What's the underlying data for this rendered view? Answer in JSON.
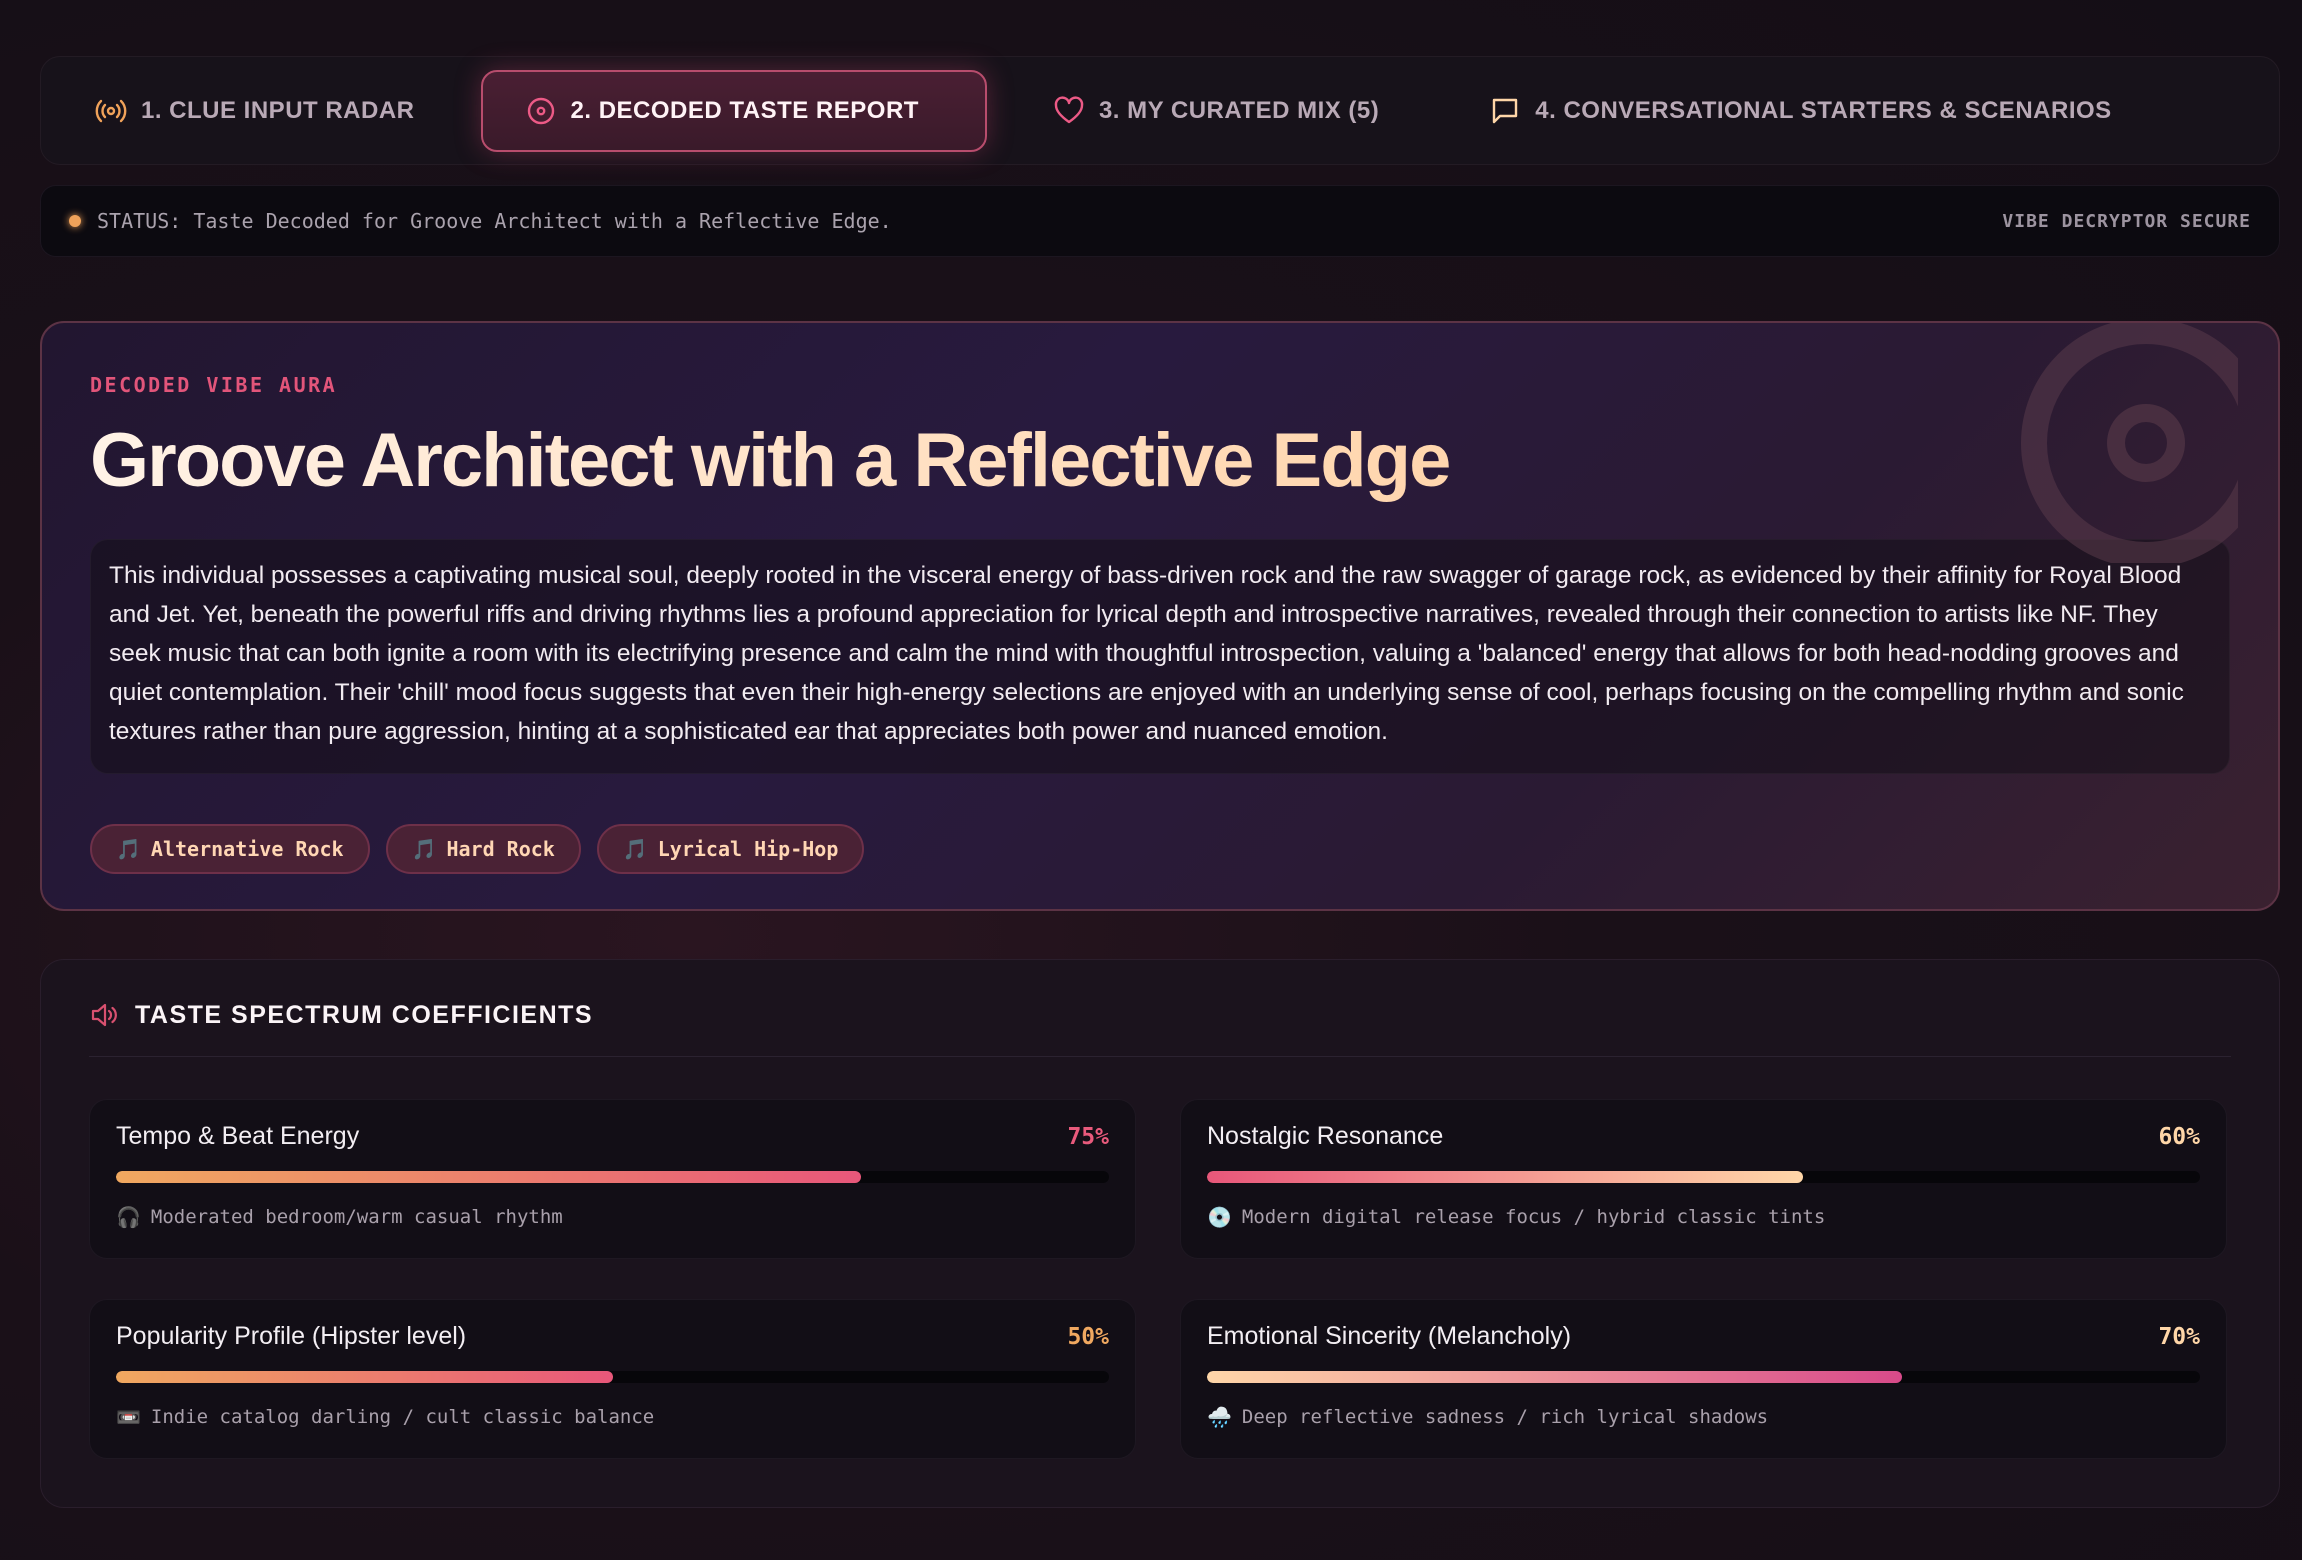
{
  "tabs": [
    {
      "label": "1. CLUE INPUT RADAR",
      "icon": "radio-broadcast-icon"
    },
    {
      "label": "2. DECODED TASTE REPORT",
      "icon": "disc-icon",
      "active": true
    },
    {
      "label": "3. MY CURATED MIX (5)",
      "icon": "heart-icon"
    },
    {
      "label": "4. CONVERSATIONAL STARTERS & SCENARIOS",
      "icon": "chat-bubble-icon"
    }
  ],
  "status": {
    "text": "STATUS: Taste Decoded for Groove Architect with a Reflective Edge.",
    "right": "VIBE DECRYPTOR SECURE"
  },
  "hero": {
    "eyebrow": "DECODED VIBE AURA",
    "title": "Groove Architect with a Reflective Edge",
    "description": "This individual possesses a captivating musical soul, deeply rooted in the visceral energy of bass-driven rock and the raw swagger of garage rock, as evidenced by their affinity for Royal Blood and Jet. Yet, beneath the powerful riffs and driving rhythms lies a profound appreciation for lyrical depth and introspective narratives, revealed through their connection to artists like NF. They seek music that can both ignite a room with its electrifying presence and calm the mind with thoughtful introspection, valuing a 'balanced' energy that allows for both head-nodding grooves and quiet contemplation. Their 'chill' mood focus suggests that even their high-energy selections are enjoyed with an underlying sense of cool, perhaps focusing on the compelling rhythm and sonic textures rather than pure aggression, hinting at a sophisticated ear that appreciates both power and nuanced emotion.",
    "chips": [
      {
        "icon": "🎵",
        "label": "Alternative Rock"
      },
      {
        "icon": "🎵",
        "label": "Hard Rock"
      },
      {
        "icon": "🎵",
        "label": "Lyrical Hip-Hop"
      }
    ]
  },
  "spectrum": {
    "title": "TASTE SPECTRUM COEFFICIENTS",
    "items": [
      {
        "name": "Tempo & Beat Energy",
        "pct_label": "75%",
        "value": 0.75,
        "icon": "🎧",
        "sub": "Moderated bedroom/warm casual rhythm",
        "pct_color": "#e85a7c",
        "gradient": [
          "#f0a860",
          "#e8577a"
        ]
      },
      {
        "name": "Nostalgic Resonance",
        "pct_label": "60%",
        "value": 0.6,
        "icon": "💿",
        "sub": "Modern digital release focus / hybrid classic tints",
        "pct_color": "#ffd6a8",
        "gradient": [
          "#e8577a",
          "#ffd6a8"
        ]
      },
      {
        "name": "Popularity Profile (Hipster level)",
        "pct_label": "50%",
        "value": 0.5,
        "icon": "📼",
        "sub": "Indie catalog darling / cult classic balance",
        "pct_color": "#f0a860",
        "gradient": [
          "#f0a860",
          "#e8577a"
        ]
      },
      {
        "name": "Emotional Sincerity (Melancholy)",
        "pct_label": "70%",
        "value": 0.7,
        "icon": "🌧️",
        "sub": "Deep reflective sadness / rich lyrical shadows",
        "pct_color": "#ffd6a8",
        "gradient": [
          "#ffd6a8",
          "#d84a8a"
        ]
      }
    ]
  }
}
